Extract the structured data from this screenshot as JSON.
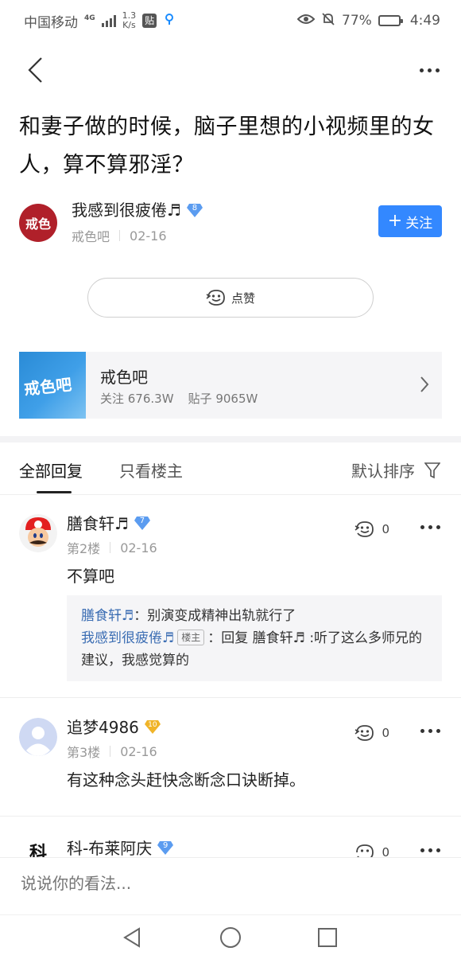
{
  "status_bar": {
    "carrier": "中国移动",
    "network_type": "4G",
    "net_speed_value": "1.3",
    "net_speed_unit": "K/s",
    "notification_badge": "贴",
    "battery_percent": "77%",
    "battery_level": 0.77,
    "time": "4:49"
  },
  "post": {
    "title": "和妻子做的时候，脑子里想的小视频里的女人，算不算邪淫？",
    "author": {
      "avatar_text": "戒色",
      "name": "我感到很疲倦♬",
      "level": "8",
      "forum": "戒色吧",
      "date": "02-16"
    },
    "follow_label": "关注",
    "like_label": "点赞"
  },
  "forum_card": {
    "logo_text": "戒色吧",
    "name": "戒色吧",
    "followers": "关注 676.3W",
    "posts": "贴子 9065W"
  },
  "tabs": {
    "all_replies": "全部回复",
    "only_op": "只看楼主",
    "sort": "默认排序"
  },
  "replies": [
    {
      "name": "膳食轩♬",
      "level": "7",
      "floor": "第2楼",
      "date": "02-16",
      "likes": "0",
      "content": "不算吧",
      "subreplies": [
        {
          "name": "膳食轩♬",
          "sep": "：",
          "text": "别演变成精神出轨就行了"
        },
        {
          "name": "我感到很疲倦♬",
          "tag": "楼主",
          "sep": "：",
          "text": "回复 膳食轩♬ :听了这么多师兄的建议，我感觉算的"
        }
      ]
    },
    {
      "name": "追梦4986",
      "level": "10",
      "floor": "第3楼",
      "date": "02-16",
      "likes": "0",
      "content": "有这种念头赶快念断念口诀断掉。"
    },
    {
      "name": "科-布莱阿庆",
      "level": "9",
      "avatar_text": "科",
      "likes": "0"
    }
  ],
  "comment_bar": {
    "placeholder": "说说你的看法..."
  },
  "colors": {
    "accent": "#3388ff",
    "link": "#3b6db3",
    "badge_blue": "#5b9cf0",
    "badge_gold": "#f0b429"
  }
}
